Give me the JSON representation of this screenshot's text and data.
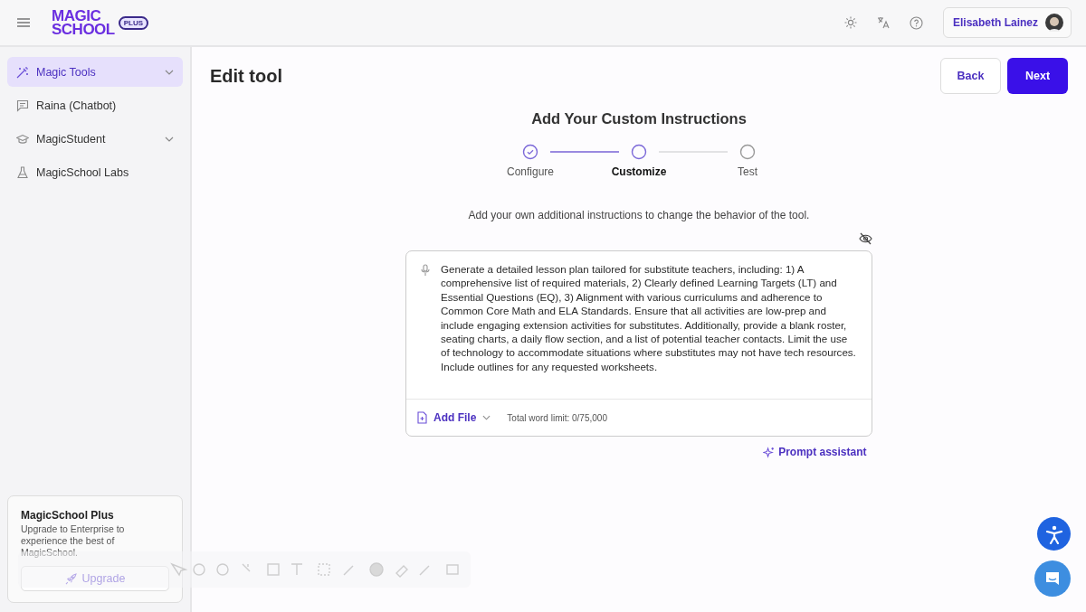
{
  "header": {
    "logo_top": "MAGIC",
    "logo_bottom": "SCHOOL",
    "logo_badge": "PLUS",
    "user_name": "Elisabeth Lainez"
  },
  "sidebar": {
    "items": [
      {
        "label": "Magic Tools",
        "kind": "wand",
        "selected": true,
        "expandable": true
      },
      {
        "label": "Raina (Chatbot)",
        "kind": "chat",
        "selected": false,
        "expandable": false
      },
      {
        "label": "MagicStudent",
        "kind": "cap",
        "selected": false,
        "expandable": true
      },
      {
        "label": "MagicSchool Labs",
        "kind": "flask",
        "selected": false,
        "expandable": false
      }
    ],
    "promo": {
      "title": "MagicSchool Plus",
      "text": "Upgrade to Enterprise to experience the best of MagicSchool.",
      "button": "Upgrade"
    }
  },
  "page": {
    "title": "Edit tool",
    "back": "Back",
    "next": "Next",
    "heading": "Add Your Custom Instructions",
    "steps": [
      {
        "label": "Configure",
        "done": true,
        "selected": false
      },
      {
        "label": "Customize",
        "done": false,
        "selected": true
      },
      {
        "label": "Test",
        "done": false,
        "selected": false
      }
    ],
    "description": "Add your own additional instructions to change the behavior of the tool.",
    "instructions": "Generate a detailed lesson plan tailored for substitute teachers, including: 1) A comprehensive list of required materials, 2) Clearly defined Learning Targets (LT) and Essential Questions (EQ), 3) Alignment with various curriculums and adherence to Common Core Math and ELA Standards. Ensure that all activities are low-prep and include engaging extension activities for substitutes. Additionally, provide a blank roster, seating charts, a daily flow section, and a list of potential teacher contacts. Limit the use of technology to accommodate situations where substitutes may not have tech resources. Include outlines for any requested worksheets.",
    "add_file": "Add File",
    "word_limit": "Total word limit: 0/75,000",
    "prompt_assistant": "Prompt assistant"
  }
}
